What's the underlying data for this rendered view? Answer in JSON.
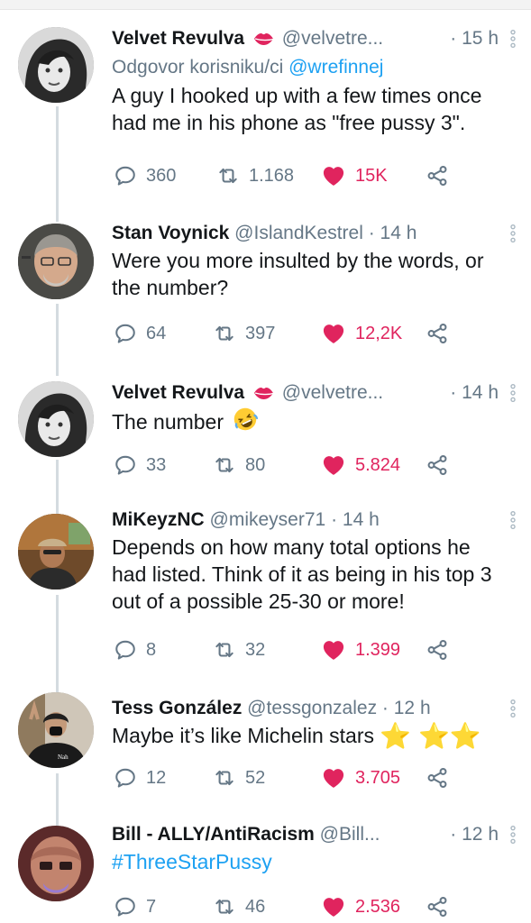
{
  "colors": {
    "link": "#1da1f2",
    "muted": "#657786",
    "like": "#e0245e",
    "text": "#14171a"
  },
  "tweets": [
    {
      "name": "Velvet Revulva",
      "name_icon": "kiss-lips-icon",
      "handle": "@velvetre...",
      "time": "· 15 h",
      "reply_prefix": "Odgovor korisniku/ci",
      "reply_handle": "@wrefinnej",
      "text": "A guy I hooked up with a few times once had me in his phone as \"free pussy 3\".",
      "replies": "360",
      "retweets": "1.168",
      "likes": "15K"
    },
    {
      "name": "Stan Voynick",
      "handle": "@IslandKestrel",
      "time": "· 14 h",
      "text": "Were you more insulted by the words, or the number?",
      "replies": "64",
      "retweets": "397",
      "likes": "12,2K"
    },
    {
      "name": "Velvet Revulva",
      "name_icon": "kiss-lips-icon",
      "handle": "@velvetre...",
      "time": "· 14 h",
      "text": "The number",
      "text_icon": "rofl-emoji-icon",
      "replies": "33",
      "retweets": "80",
      "likes": "5.824"
    },
    {
      "name": "MiKeyzNC",
      "handle": "@mikeyser71",
      "time": "· 14 h",
      "text": "Depends on how many total options he had listed. Think of it as being in his top 3 out of a possible 25-30 or more!",
      "replies": "8",
      "retweets": "32",
      "likes": "1.399"
    },
    {
      "name": "Tess González",
      "handle": "@tessgonzalez",
      "time": "· 12 h",
      "text": "Maybe it’s like Michelin stars",
      "text_emoji": "⭐ ⭐⭐",
      "replies": "12",
      "retweets": "52",
      "likes": "3.705"
    },
    {
      "name": "Bill - ALLY/AntiRacism",
      "handle": "@Bill...",
      "time": "· 12 h",
      "hashtag": "#ThreeStarPussy",
      "replies": "7",
      "retweets": "46",
      "likes": "2.536"
    }
  ]
}
